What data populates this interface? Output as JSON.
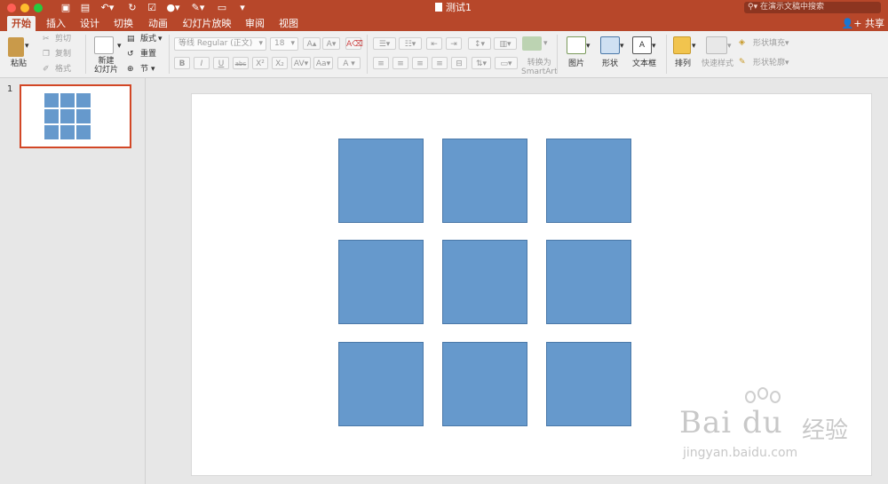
{
  "window": {
    "document_title": "测试1",
    "search_placeholder": "在演示文稿中搜索",
    "share_label": "共享"
  },
  "tabs": [
    "开始",
    "插入",
    "设计",
    "切换",
    "动画",
    "幻灯片放映",
    "审阅",
    "视图"
  ],
  "active_tab": "开始",
  "ribbon": {
    "paste": "粘贴",
    "cut": "剪切",
    "copy": "复制",
    "format": "格式",
    "new_slide": "新建\n幻灯片",
    "layout": "版式",
    "reset": "重置",
    "section": "节",
    "font_name": "等线 Regular (正文)",
    "font_size": "18",
    "convert_smartart": "转换为\nSmartArt",
    "picture": "图片",
    "shape": "形状",
    "textbox": "文本框",
    "arrange": "排列",
    "quick_styles": "快速样式",
    "shape_fill": "形状填充",
    "shape_outline": "形状轮廓"
  },
  "slides_pane": {
    "slide_number": "1"
  },
  "slide": {
    "shape_color": "#6699cc",
    "grid_rows": 3,
    "grid_cols": 3
  },
  "watermark": {
    "brand": "Bai du",
    "brand_cn": "经验",
    "url": "jingyan.baidu.com"
  }
}
